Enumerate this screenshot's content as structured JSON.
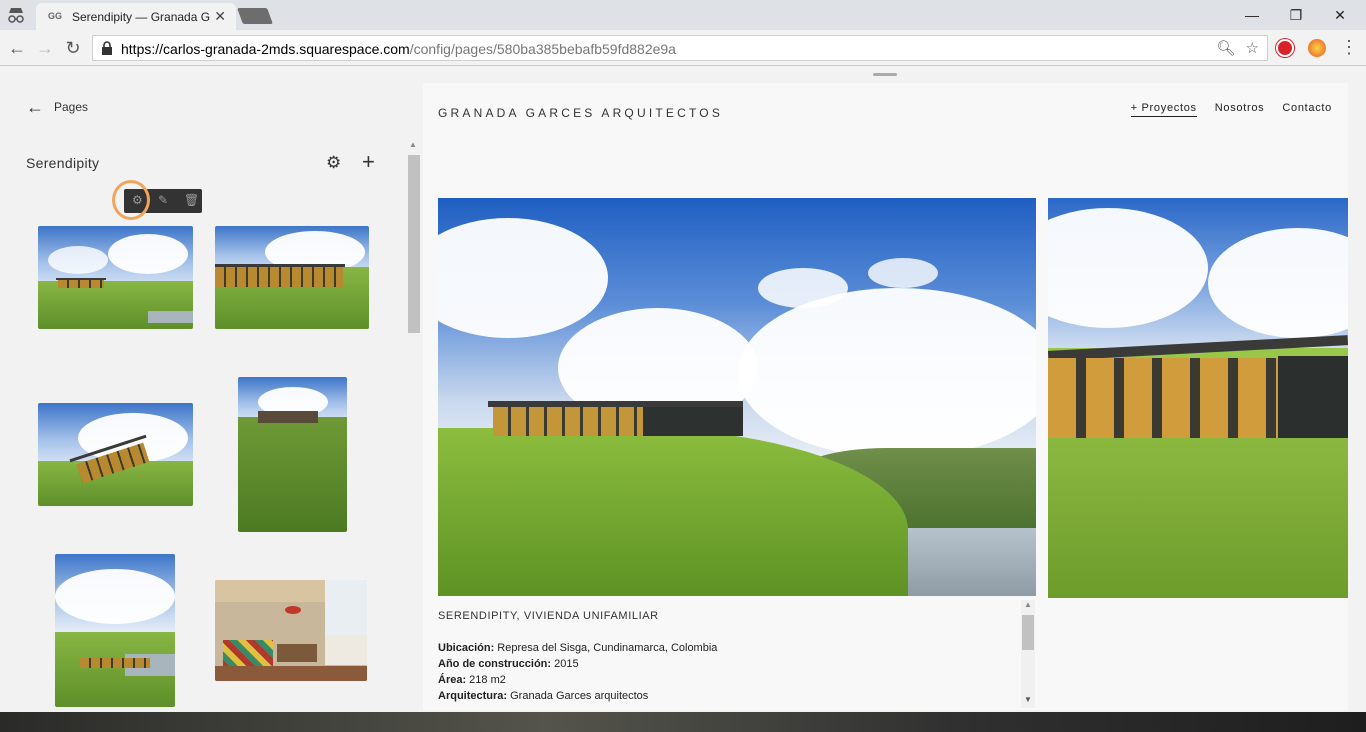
{
  "browser": {
    "tab_favicon": "GG",
    "tab_title": "Serendipity — Granada G",
    "tab_close": "✕",
    "url_scheme": "https://",
    "url_host": "carlos-granada-2mds.squarespace.com",
    "url_path": "/config/pages/580ba385bebafb59fd882e9a",
    "window_minimize": "—",
    "window_maximize": "❐",
    "window_close": "✕"
  },
  "sidebar": {
    "back_label": "Pages",
    "page_title": "Serendipity"
  },
  "site": {
    "brand": "GRANADA GARCES ARQUITECTOS",
    "nav": [
      "+ Proyectos",
      "Nosotros",
      "Contacto"
    ],
    "caption_title": "SERENDIPITY, VIVIENDA UNIFAMILIAR",
    "details": [
      {
        "label": "Ubicación:",
        "value": " Represa del Sisga, Cundinamarca, Colombia"
      },
      {
        "label": "Año de construcción:",
        "value": " 2015"
      },
      {
        "label": "Área:",
        "value": " 218 m2"
      },
      {
        "label": "Arquitectura:",
        "value": " Granada Garces arquitectos"
      }
    ]
  },
  "colors": {
    "accent_ring": "#f0a55c",
    "titlebar": "#dee1e6"
  }
}
